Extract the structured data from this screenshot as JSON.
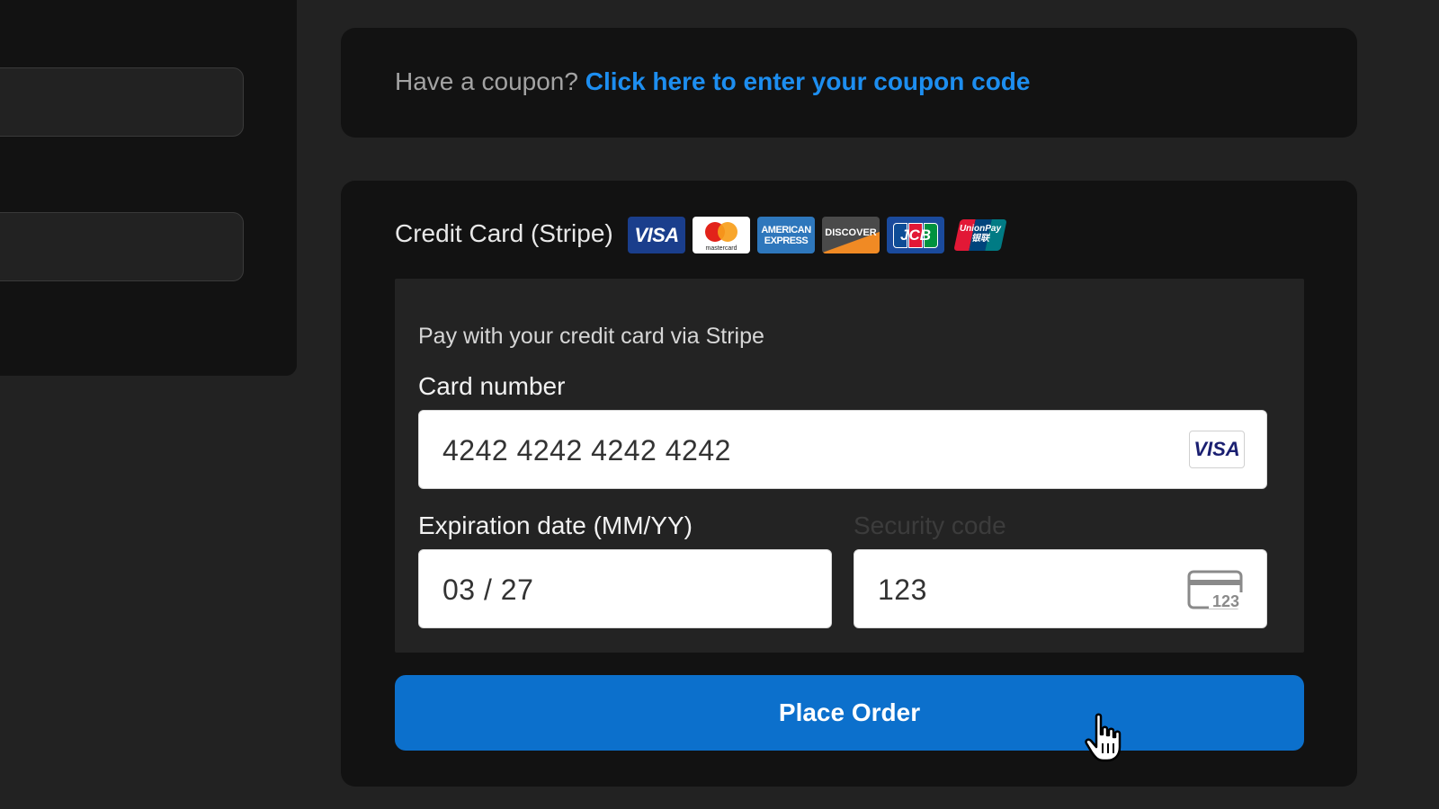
{
  "coupon": {
    "prefix": "Have a coupon?",
    "link": "Click here to enter your coupon code"
  },
  "payment": {
    "method_label": "Credit Card (Stripe)",
    "card_logos": [
      {
        "name": "visa",
        "text": "VISA"
      },
      {
        "name": "mastercard",
        "text": "mastercard"
      },
      {
        "name": "amex",
        "text_top": "AMERICAN",
        "text_bottom": "EXPRESS"
      },
      {
        "name": "discover",
        "text": "DISCOVER"
      },
      {
        "name": "jcb",
        "text": "JCB"
      },
      {
        "name": "unionpay",
        "text_top": "UnionPay",
        "text_bottom": "银联"
      }
    ],
    "description": "Pay with your credit card via Stripe",
    "card_number": {
      "label": "Card number",
      "value": "4242 4242 4242 4242",
      "brand_icon": "VISA"
    },
    "expiry": {
      "label": "Expiration date (MM/YY)",
      "value": "03 / 27"
    },
    "cvc": {
      "label": "Security code",
      "value": "123",
      "icon_text": "123"
    },
    "place_order_label": "Place Order"
  },
  "colors": {
    "page_bg": "#222222",
    "card_bg": "#121212",
    "link": "#1d8ef0",
    "button": "#0c70cc"
  }
}
